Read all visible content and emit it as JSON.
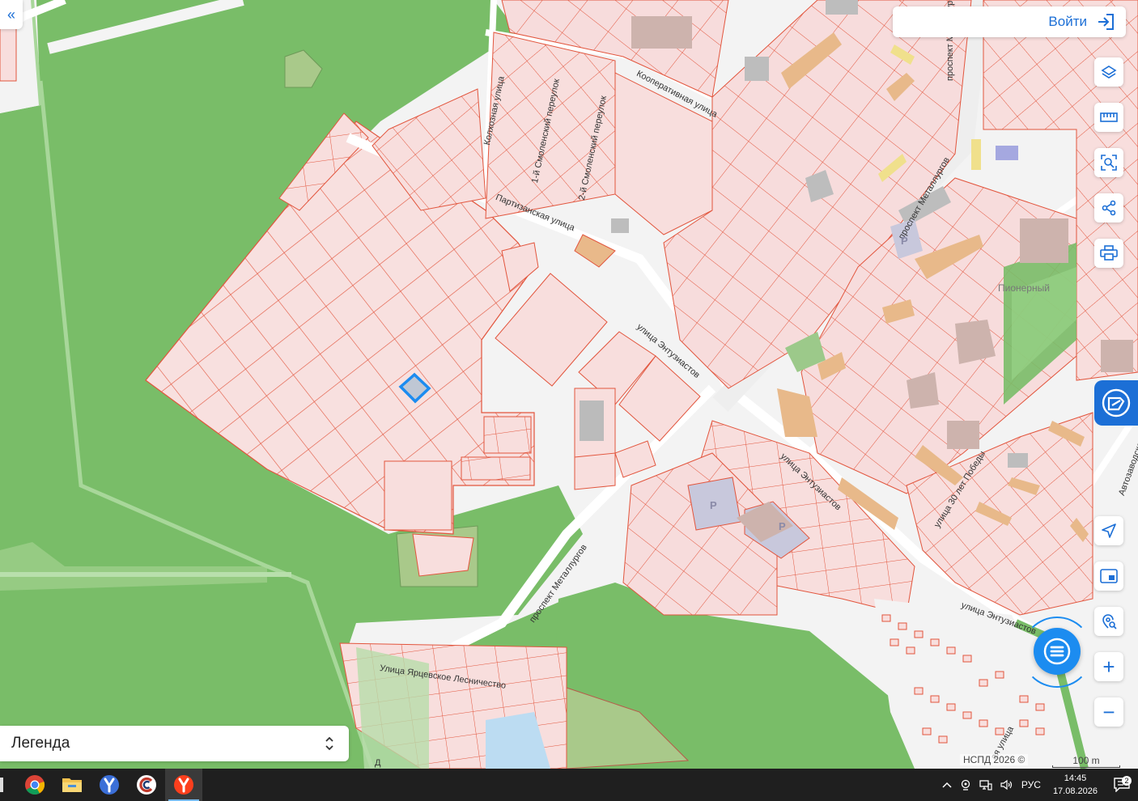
{
  "header": {
    "login_label": "Войти"
  },
  "legend": {
    "label": "Легенда"
  },
  "map": {
    "streets": [
      "Колхозная улица",
      "1-й Смоленский переулок",
      "2-й Смоленский переулок",
      "Кооперативная улица",
      "Партизанская улица",
      "улица Энтузиастов",
      "проспект Металлургов",
      "улица Энтузиастов",
      "улица Энтузиастов",
      "улица 30 лет Победы",
      "проспект Металлургов",
      "Автозаводская",
      "Улица Ярцевское Лесничество",
      "проспект Металлургов",
      "ая улица",
      "Д"
    ],
    "poi_label": "Пионерный",
    "parking_labels": [
      "P",
      "P",
      "P"
    ],
    "copyright": "НСПД 2026 ©",
    "scale_label": "100 m"
  },
  "toolbar": {
    "icons": [
      "layers-icon",
      "ruler-icon",
      "area-select-icon",
      "share-icon",
      "print-icon",
      "locate-icon",
      "minimap-icon",
      "geo-search-icon"
    ],
    "zoom_in": "+",
    "zoom_out": "−"
  },
  "taskbar": {
    "apps": [
      "chrome",
      "file-explorer",
      "yandex-browser",
      "ccleaner",
      "yandex"
    ],
    "language": "РУС",
    "time": "14:45",
    "date": "17.08.2026",
    "notifications": "2"
  },
  "colors": {
    "accent": "#1c6fd6",
    "forest": "#79bd68",
    "parcel_fill": "#f7dede",
    "parcel_stroke": "#e2553d",
    "selected_parcel": "#1c8cf0"
  }
}
